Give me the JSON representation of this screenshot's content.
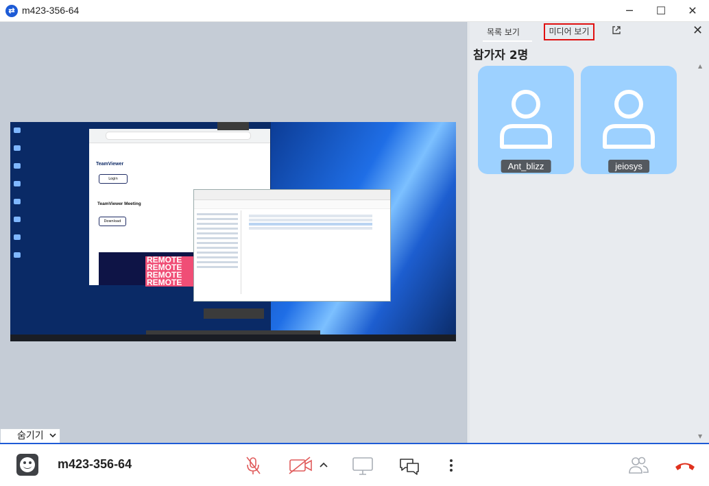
{
  "window": {
    "title": "m423-356-64",
    "logo_icon": "teamviewer-logo-icon",
    "controls": {
      "minimize": "─",
      "maximize": "☐",
      "close": "✕"
    }
  },
  "stage": {
    "hide_label": "숨기기",
    "remote_screen": {
      "browser_brand": "TeamViewer",
      "login_label": "Login",
      "heading": "TeamViewer Meeting",
      "download_label": "Download",
      "banner_text": [
        "REMOTE",
        "REMOTE",
        "REMOTE",
        "REMOTE"
      ]
    }
  },
  "panel": {
    "tabs": {
      "list": "목록 보기",
      "media": "미디어 보기"
    },
    "participant_count": "참가자 2명",
    "participants": [
      {
        "name": "Ant_blizz"
      },
      {
        "name": "jeiosys"
      }
    ]
  },
  "toolbar": {
    "meeting_id": "m423-356-64",
    "icons": {
      "mic": "mic-muted-icon",
      "camera": "camera-off-icon",
      "camera_menu": "chevron-up-icon",
      "screen": "screen-share-icon",
      "chat": "chat-icon",
      "more": "more-vertical-icon",
      "participants": "participants-icon",
      "end": "hang-up-icon"
    },
    "colors": {
      "muted": "#e05a5a",
      "end": "#e0321e",
      "disabled": "#a9aeb5",
      "accent": "#1e5bd6"
    }
  }
}
